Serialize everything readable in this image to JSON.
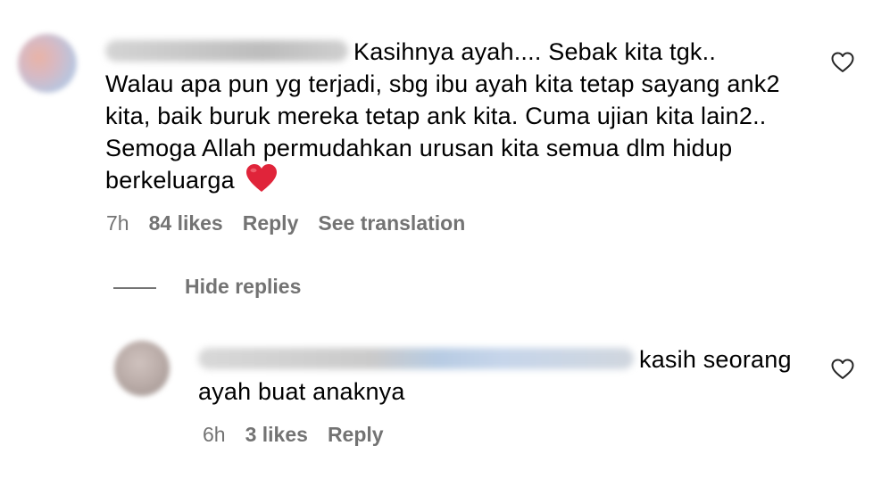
{
  "comment": {
    "username": "",
    "text_line1": "Kasihnya ayah.... Sebak kita tgk..",
    "text_rest": "Walau apa pun yg terjadi, sbg ibu ayah kita tetap sayang ank2 kita, baik buruk mereka tetap ank kita. Cuma ujian kita lain2.. Semoga Allah permudahkan urusan kita semua dlm hidup berkeluarga",
    "emoji": "red-heart",
    "time": "7h",
    "likes": "84 likes",
    "reply_label": "Reply",
    "translate_label": "See translation",
    "like_icon": "heart-outline-icon"
  },
  "replies_toggle": {
    "label": "Hide replies"
  },
  "reply": {
    "username": "",
    "text": "kasih seorang ayah buat anaknya",
    "time": "6h",
    "likes": "3 likes",
    "reply_label": "Reply",
    "like_icon": "heart-outline-icon"
  },
  "colors": {
    "text": "#000000",
    "muted": "#737373",
    "heart": "#e0243a"
  }
}
